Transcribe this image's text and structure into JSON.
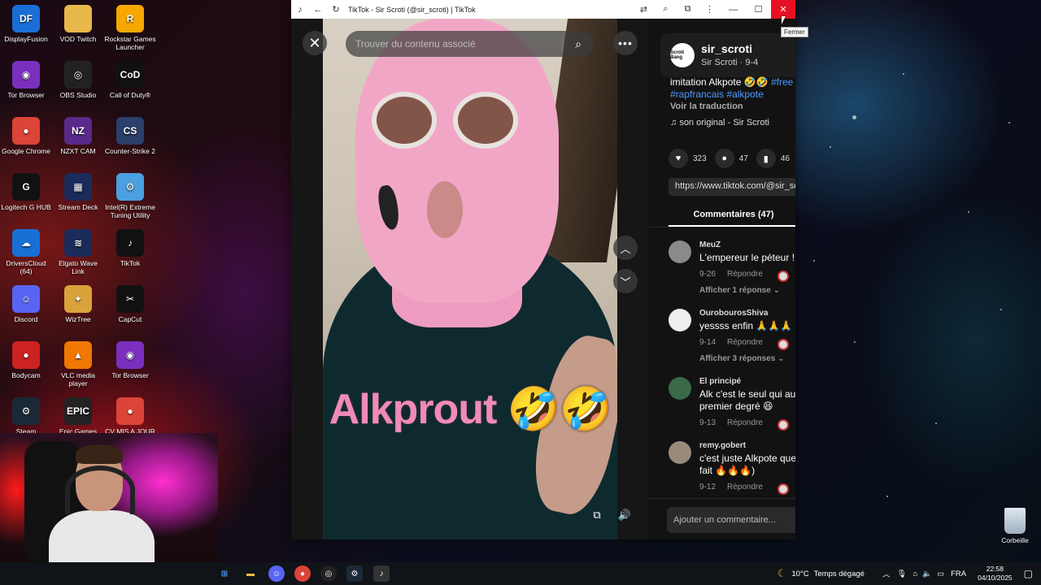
{
  "desktop": {
    "icons": [
      {
        "label": "DisplayFusion",
        "icon": "displayfusion-icon",
        "color": "#1a6fd6",
        "glyph": "DF"
      },
      {
        "label": "VOD Twitch",
        "icon": "folder-icon",
        "color": "#e8b84a",
        "glyph": ""
      },
      {
        "label": "Rockstar Games Launcher",
        "icon": "rockstar-icon",
        "color": "#f6a800",
        "glyph": "R"
      },
      {
        "label": "Tor Browser",
        "icon": "tor-icon",
        "color": "#7a2fbf",
        "glyph": "◉"
      },
      {
        "label": "OBS Studio",
        "icon": "obs-icon",
        "color": "#222",
        "glyph": "◎"
      },
      {
        "label": "Call of Duty®",
        "icon": "cod-icon",
        "color": "#111",
        "glyph": "CoD"
      },
      {
        "label": "Google Chrome",
        "icon": "chrome-icon",
        "color": "#db4437",
        "glyph": "●"
      },
      {
        "label": "NZXT CAM",
        "icon": "nzxt-icon",
        "color": "#5a2a8a",
        "glyph": "NZ"
      },
      {
        "label": "Counter-Strike 2",
        "icon": "cs2-icon",
        "color": "#2a3f6a",
        "glyph": "CS"
      },
      {
        "label": "Logitech G HUB",
        "icon": "ghub-icon",
        "color": "#111",
        "glyph": "G"
      },
      {
        "label": "Stream Deck",
        "icon": "streamdeck-icon",
        "color": "#1b2b5a",
        "glyph": "▦"
      },
      {
        "label": "Intel(R) Extreme Tuning Utility",
        "icon": "intel-icon",
        "color": "#4aa0e0",
        "glyph": "⚙"
      },
      {
        "label": "DriversCloud (64)",
        "icon": "driverscloud-icon",
        "color": "#1a6fd6",
        "glyph": "☁"
      },
      {
        "label": "Elgato Wave Link",
        "icon": "wavelink-icon",
        "color": "#1b2b5a",
        "glyph": "≋"
      },
      {
        "label": "TikTok",
        "icon": "tiktok-icon",
        "color": "#111",
        "glyph": "♪"
      },
      {
        "label": "Discord",
        "icon": "discord-icon",
        "color": "#5865f2",
        "glyph": "☺"
      },
      {
        "label": "WizTree",
        "icon": "wiztree-icon",
        "color": "#d9a23a",
        "glyph": "✦"
      },
      {
        "label": "CapCut",
        "icon": "capcut-icon",
        "color": "#111",
        "glyph": "✂"
      },
      {
        "label": "Bodycam",
        "icon": "bodycam-icon",
        "color": "#c22",
        "glyph": "●"
      },
      {
        "label": "VLC media player",
        "icon": "vlc-icon",
        "color": "#f07800",
        "glyph": "▲"
      },
      {
        "label": "Tor Browser",
        "icon": "tor-icon",
        "color": "#7a2fbf",
        "glyph": "◉"
      },
      {
        "label": "Steam",
        "icon": "steam-icon",
        "color": "#1b2838",
        "glyph": "⚙"
      },
      {
        "label": "Epic Games",
        "icon": "epic-icon",
        "color": "#222",
        "glyph": "EPIC"
      },
      {
        "label": "CV MIS A JOUR",
        "icon": "chrome-doc-icon",
        "color": "#db4437",
        "glyph": "●"
      }
    ],
    "recycle_bin": "Corbeille"
  },
  "window": {
    "title": "TikTok - Sir Scroti (@sir_scroti) | TikTok",
    "close_tooltip": "Fermer"
  },
  "video": {
    "search_placeholder": "Trouver du contenu associé",
    "caption": "Alkprout 🤣🤣"
  },
  "panel": {
    "author_name": "sir_scroti",
    "author_sub": "Sir Scroti · 9-4",
    "avatar_text": "Scroti Bang",
    "description_text": "imitation Alkpote 🤣🤣",
    "hashtag_1": "#free",
    "hashtag_2": "#rapfrancais",
    "hashtag_3": "#alkpote",
    "translate": "Voir la traduction",
    "music": "son original - Sir Scroti",
    "likes": "323",
    "comments_count": "47",
    "saves": "46",
    "link": "https://www.tiktok.com/@sir_scroti",
    "comments_tab": "Commentaires (47)",
    "comment_placeholder": "Ajouter un commentaire..."
  },
  "comments": [
    {
      "user": "MeuZ",
      "text": "L'empereur le péteur !",
      "date": "9-26",
      "reply": "Répondre",
      "more": "Afficher 1 réponse"
    },
    {
      "user": "OurobourosShiva",
      "text": "yessss enfin 🙏🙏🙏",
      "date": "9-14",
      "reply": "Répondre",
      "more": "Afficher 3 réponses"
    },
    {
      "user": "El principé",
      "text": "Alk c'est le seul qui au",
      "text2": "premier degré 😆",
      "date": "9-13",
      "reply": "Répondre"
    },
    {
      "user": "remy.gobert",
      "text": "c'est juste Alkpote que",
      "text2": "fait 🔥🔥🔥)",
      "date": "9-12",
      "reply": "Répondre"
    }
  ],
  "taskbar": {
    "weather": "10°C",
    "weather_text": "Temps dégagé",
    "lang": "FRA",
    "time": "22:58",
    "date": "04/10/2025"
  }
}
